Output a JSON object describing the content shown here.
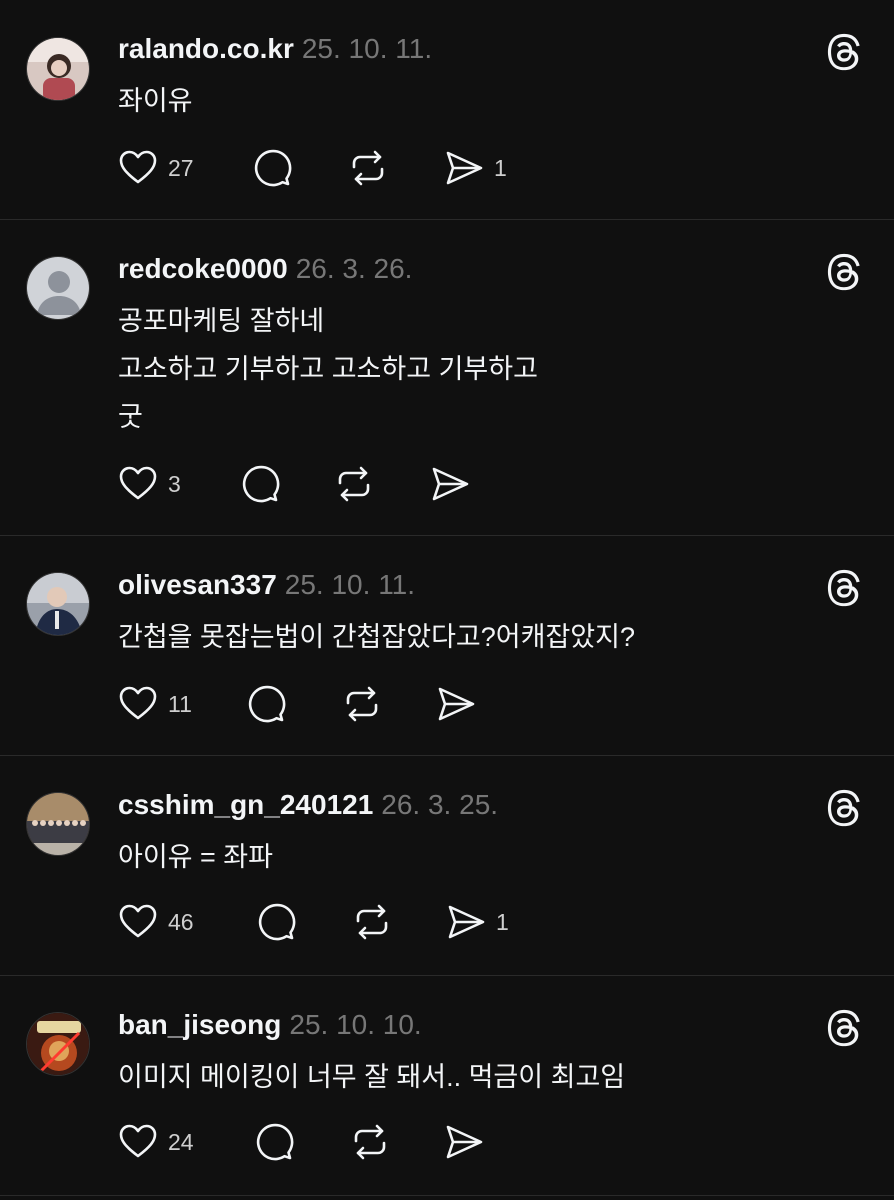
{
  "posts": [
    {
      "username": "ralando.co.kr",
      "date": "25. 10. 11.",
      "lines": [
        "좌이유"
      ],
      "likes": "27",
      "shares": "1",
      "avatar_color": "#c9b7b2"
    },
    {
      "username": "redcoke0000",
      "date": "26. 3. 26.",
      "lines": [
        "공포마케팅 잘하네",
        "고소하고 기부하고 고소하고 기부하고",
        "굿"
      ],
      "likes": "3",
      "shares": "",
      "avatar_color": "#d0d3d8"
    },
    {
      "username": "olivesan337",
      "date": "25. 10. 11.",
      "lines": [
        "간첩을 못잡는법이 간첩잡았다고?어캐잡았지?"
      ],
      "likes": "11",
      "shares": "",
      "avatar_color": "#8a8f99"
    },
    {
      "username": "csshim_gn_240121",
      "date": "26. 3. 25.",
      "lines": [
        "아이유 = 좌파"
      ],
      "likes": "46",
      "shares": "1",
      "avatar_color": "#6d5a4a"
    },
    {
      "username": "ban_jiseong",
      "date": "25. 10. 10.",
      "lines": [
        "이미지 메이킹이 너무 잘 돼서.. 먹금이 최고임"
      ],
      "likes": "24",
      "shares": "",
      "avatar_color": "#5a2a1e"
    }
  ],
  "icons": {
    "like": "heart-icon",
    "reply": "comment-icon",
    "repost": "repost-icon",
    "share": "send-icon",
    "logo": "threads-logo-icon"
  },
  "colors": {
    "background": "#101010",
    "text": "#f3f5f7",
    "muted": "#777777",
    "divider": "#2a2a2a"
  }
}
